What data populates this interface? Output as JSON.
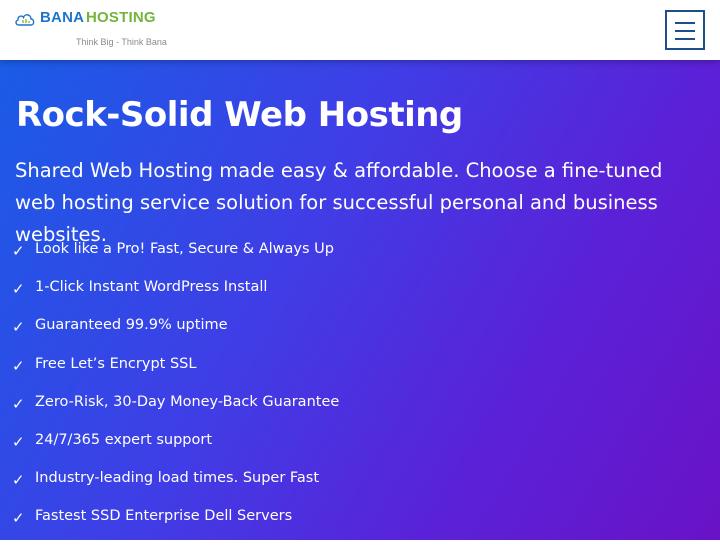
{
  "header": {
    "logo": {
      "brand_part1": "BANA",
      "brand_part2": "HOSTING",
      "tagline": "Think Big - Think Bana"
    },
    "menu_icon": "hamburger-menu-icon"
  },
  "hero": {
    "title": "Rock-Solid Web Hosting",
    "subtitle": "Shared Web Hosting made easy & affordable. Choose a fine-tuned web hosting service solution for successful personal and business websites.",
    "check_glyph": "✓",
    "features": [
      "Look like a Pro! Fast, Secure & Always Up",
      "1-Click Instant WordPress Install",
      "Guaranteed 99.9% uptime",
      "Free Let’s Encrypt SSL",
      "Zero-Risk, 30-Day Money-Back Guarantee",
      "24/7/365 expert support",
      "Industry-leading load times. Super Fast",
      "Fastest SSD Enterprise Dell Servers"
    ]
  },
  "colors": {
    "brand_blue": "#1f76c8",
    "brand_green": "#72b53a",
    "menu_border": "#1d4f8c",
    "hero_gradient_start": "#1a5ce6",
    "hero_gradient_end": "#6a12c6"
  }
}
